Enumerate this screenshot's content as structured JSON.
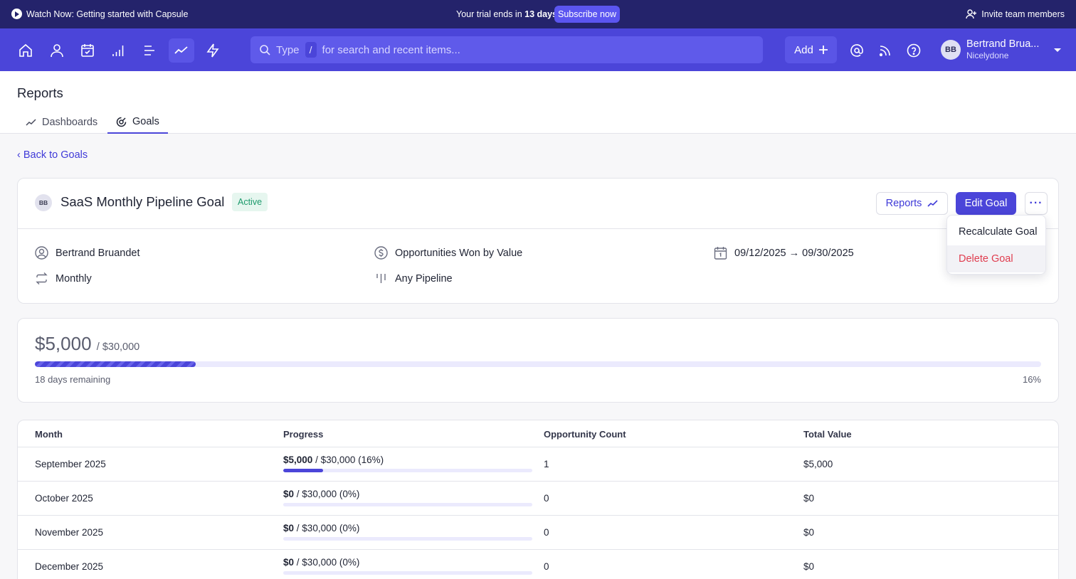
{
  "announcement": {
    "watch_text": "Watch Now: Getting started with Capsule",
    "trial_prefix": "Your trial ends in",
    "trial_days": "13 days",
    "subscribe_label": "Subscribe now",
    "invite_label": "Invite team members"
  },
  "nav": {
    "icons": [
      "home-icon",
      "person-icon",
      "calendar-check-icon",
      "bar-chart-icon",
      "list-icon",
      "trend-line-icon",
      "lightning-icon"
    ],
    "active_icon": "trend-line-icon",
    "search": {
      "prefix": "Type",
      "slash": "/",
      "placeholder": "for search and recent items..."
    },
    "add_label": "Add",
    "add_icon": "plus-icon",
    "right_icons": [
      "at-icon",
      "rss-icon",
      "help-icon"
    ],
    "user": {
      "initials": "BB",
      "name": "Bertrand Brua...",
      "org": "Nicelydone"
    }
  },
  "page": {
    "title": "Reports",
    "tabs": [
      {
        "label": "Dashboards",
        "icon": "trend-line-icon",
        "active": false
      },
      {
        "label": "Goals",
        "icon": "goal-icon",
        "active": true
      }
    ],
    "back_label": "‹ Back to Goals"
  },
  "goal": {
    "owner_initials": "BB",
    "title": "SaaS Monthly Pipeline Goal",
    "status": "Active",
    "reports_label": "Reports",
    "edit_label": "Edit Goal",
    "more_label": "···",
    "menu": [
      "Recalculate Goal",
      "Delete Goal"
    ],
    "details": {
      "owner": "Bertrand Bruandet",
      "frequency": "Monthly",
      "metric": "Opportunities Won by Value",
      "pipeline": "Any Pipeline",
      "date_range": "09/12/2025 → 09/30/2025"
    }
  },
  "summary": {
    "current": "$5,000",
    "target": "/ $30,000",
    "progress_fraction": 0.16,
    "remaining": "18 days remaining",
    "percent": "16%"
  },
  "table": {
    "columns": [
      "Month",
      "Progress",
      "Opportunity Count",
      "Total Value"
    ],
    "rows": [
      {
        "month": "September 2025",
        "current": "$5,000",
        "target": "/ $30,000 (16%)",
        "fraction": 0.16,
        "count": "1",
        "total": "$5,000"
      },
      {
        "month": "October 2025",
        "current": "$0",
        "target": "/ $30,000 (0%)",
        "fraction": 0,
        "count": "0",
        "total": "$0"
      },
      {
        "month": "November 2025",
        "current": "$0",
        "target": "/ $30,000 (0%)",
        "fraction": 0,
        "count": "0",
        "total": "$0"
      },
      {
        "month": "December 2025",
        "current": "$0",
        "target": "/ $30,000 (0%)",
        "fraction": 0,
        "count": "0",
        "total": "$0"
      }
    ]
  },
  "colors": {
    "brand": "#4b45d9",
    "announce_bg": "#24236b",
    "active_badge": "#1d9a6c",
    "danger": "#e03d4f"
  }
}
